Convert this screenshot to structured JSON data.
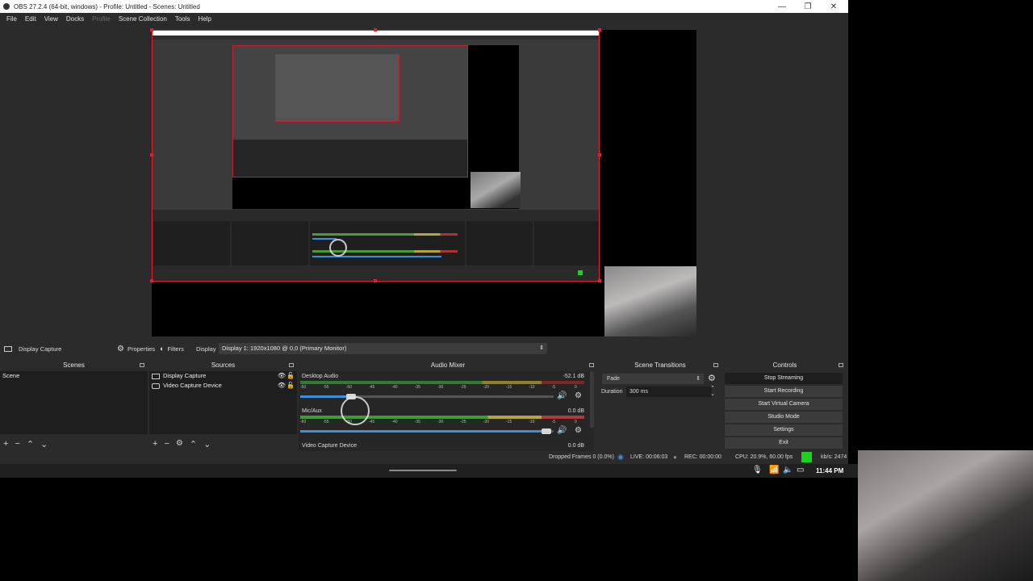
{
  "window": {
    "title": "OBS 27.2.4 (64-bit, windows) - Profile: Untitled - Scenes: Untitled",
    "minimize_glyph": "—",
    "restore_glyph": "❐",
    "close_glyph": "✕"
  },
  "menu": [
    "File",
    "Edit",
    "View",
    "Docks",
    "Profile",
    "Scene Collection",
    "Tools",
    "Help"
  ],
  "source_toolbar": {
    "source_name": "Display Capture",
    "properties_label": "Properties",
    "filters_label": "Filters",
    "display_label": "Display",
    "display_value": "Display 1: 1920x1080 @ 0,0 (Primary Monitor)"
  },
  "scenes": {
    "title": "Scenes",
    "items": [
      "Scene"
    ]
  },
  "sources": {
    "title": "Sources",
    "items": [
      "Display Capture",
      "Video Capture Device"
    ]
  },
  "audio_mixer": {
    "title": "Audio Mixer",
    "tick_labels": [
      "-60",
      "-55",
      "-50",
      "-45",
      "-40",
      "-35",
      "-30",
      "-25",
      "-20",
      "-15",
      "-10",
      "-5",
      "0"
    ],
    "channels": [
      {
        "name": "Desktop Audio",
        "db": "-52.1 dB",
        "volume": 0.2
      },
      {
        "name": "Mic/Aux",
        "db": "0.0 dB",
        "volume": 0.97
      },
      {
        "name": "Video Capture Device",
        "db": "0.0 dB"
      }
    ]
  },
  "scene_transitions": {
    "title": "Scene Transitions",
    "transition": "Fade",
    "duration_label": "Duration",
    "duration_value": "300 ms"
  },
  "controls": {
    "title": "Controls",
    "buttons": [
      "Stop Streaming",
      "Start Recording",
      "Start Virtual Camera",
      "Studio Mode",
      "Settings",
      "Exit"
    ]
  },
  "status": {
    "dropped_frames": "Dropped Frames 0 (0.0%)",
    "live": "LIVE: 00:06:03",
    "rec": "REC: 00:00:00",
    "cpu": "CPU: 20.9%, 60.00 fps",
    "kbps": "kb/s: 2474"
  },
  "taskbar": {
    "time": "11:44 PM"
  },
  "colors": {
    "accent_blue": "#3d8fd9",
    "selection_red": "#e2202f",
    "status_green": "#1fd11f"
  }
}
